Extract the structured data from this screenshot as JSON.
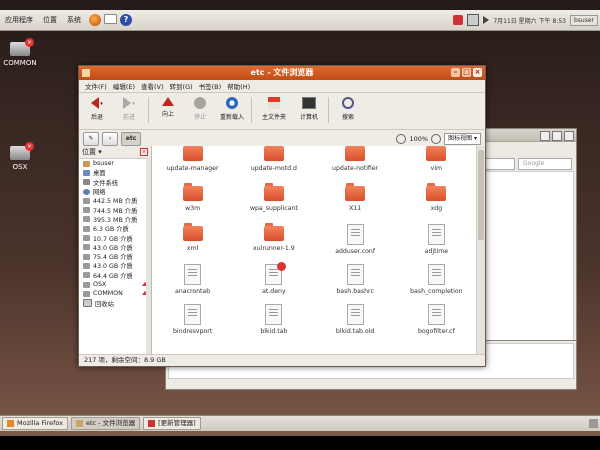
{
  "top_panel": {
    "menus": [
      "应用程序",
      "位置",
      "系统"
    ],
    "datetime": "7月11日 星期六 下午 8:53",
    "user": "bsuser"
  },
  "desktop": {
    "icons": [
      {
        "label": "COMMON"
      },
      {
        "label": "OSX"
      }
    ]
  },
  "window": {
    "title": "etc - 文件浏览器",
    "menus": [
      "文件(F)",
      "编辑(E)",
      "查看(V)",
      "转到(G)",
      "书签(B)",
      "帮助(H)"
    ],
    "toolbar": {
      "back": "后退",
      "forward": "前进",
      "up": "向上",
      "stop": "停止",
      "reload": "重新载入",
      "home": "主文件夹",
      "computer": "计算机",
      "search": "搜索"
    },
    "location": {
      "current": "etc",
      "zoom": "100%",
      "view": "图标视图"
    },
    "sidebar": {
      "header": "位置",
      "items": [
        {
          "label": "bsuser",
          "icon": "home-icon"
        },
        {
          "label": "桌面",
          "icon": "desktop-icon"
        },
        {
          "label": "文件系统",
          "icon": "filesystem-icon"
        },
        {
          "label": "网络",
          "icon": "network-icon"
        },
        {
          "label": "442.5 MB 介质",
          "icon": "drive-icon"
        },
        {
          "label": "744.5 MB 介质",
          "icon": "drive-icon"
        },
        {
          "label": "395.3 MB 介质",
          "icon": "drive-icon"
        },
        {
          "label": "6.3 GB 介质",
          "icon": "drive-icon"
        },
        {
          "label": "10.7 GB 介质",
          "icon": "drive-icon"
        },
        {
          "label": "43.0 GB 介质",
          "icon": "drive-icon"
        },
        {
          "label": "75.4 GB 介质",
          "icon": "drive-icon"
        },
        {
          "label": "43.0 GB 介质",
          "icon": "drive-icon"
        },
        {
          "label": "64.4 GB 介质",
          "icon": "drive-icon"
        },
        {
          "label": "OSX",
          "icon": "drive-icon",
          "eject": true
        },
        {
          "label": "COMMON",
          "icon": "drive-icon",
          "eject": true
        },
        {
          "label": "回收站",
          "icon": "trash-icon"
        }
      ]
    },
    "files": [
      {
        "name": "update-manager",
        "type": "folder"
      },
      {
        "name": "update-motd.d",
        "type": "folder"
      },
      {
        "name": "update-notifier",
        "type": "folder"
      },
      {
        "name": "vim",
        "type": "folder"
      },
      {
        "name": "w3m",
        "type": "folder"
      },
      {
        "name": "wpa_supplicant",
        "type": "folder"
      },
      {
        "name": "X11",
        "type": "folder"
      },
      {
        "name": "xdg",
        "type": "folder"
      },
      {
        "name": "xml",
        "type": "folder"
      },
      {
        "name": "xulrunner-1.9",
        "type": "folder"
      },
      {
        "name": "adduser.conf",
        "type": "file"
      },
      {
        "name": "adjtime",
        "type": "file"
      },
      {
        "name": "anacrontab",
        "type": "file"
      },
      {
        "name": "at.deny",
        "type": "file",
        "badge": true
      },
      {
        "name": "bash.bashrc",
        "type": "file"
      },
      {
        "name": "bash_completion",
        "type": "file"
      },
      {
        "name": "bindresvport",
        "type": "file"
      },
      {
        "name": "blkid.tab",
        "type": "file"
      },
      {
        "name": "blkid.tab.old",
        "type": "file"
      },
      {
        "name": "bogofilter.cf",
        "type": "file"
      }
    ],
    "status": "217 项，剩余空间：8.9 GB"
  },
  "background_window": {
    "search_placeholder": "Google"
  },
  "taskbar": {
    "items": [
      {
        "label": "Mozilla Firefox",
        "active": false
      },
      {
        "label": "etc - 文件浏览器",
        "active": true
      },
      {
        "label": "[更新管理器]",
        "active": false
      }
    ]
  }
}
